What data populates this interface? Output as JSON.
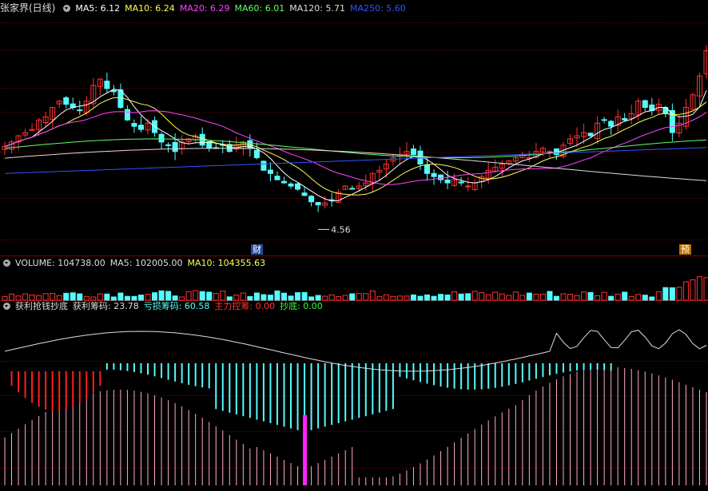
{
  "main": {
    "title": "张家界(日线)",
    "ma_labels": [
      {
        "text": "MA5: 6.12",
        "color": "#ffffff"
      },
      {
        "text": "MA10: 6.24",
        "color": "#ffff55"
      },
      {
        "text": "MA20: 6.29",
        "color": "#ff44ff"
      },
      {
        "text": "MA60: 6.01",
        "color": "#66ff66"
      },
      {
        "text": "MA120: 5.71",
        "color": "#dddddd"
      },
      {
        "text": "MA250: 5.60",
        "color": "#3355ff"
      }
    ],
    "low_label": "4.56",
    "badge_left": "财",
    "badge_right": "预"
  },
  "volume": {
    "labels": [
      {
        "text": "VOLUME: 104738.00",
        "color": "#dddddd"
      },
      {
        "text": "MA5: 102005.00",
        "color": "#dddddd"
      },
      {
        "text": "MA10: 104355.63",
        "color": "#ffff55"
      }
    ]
  },
  "indicator": {
    "labels": [
      {
        "text": "获利抢钱抄底",
        "color": "#dddddd"
      },
      {
        "text": "获利筹码: 23.78",
        "color": "#dddddd"
      },
      {
        "text": "亏损筹码: 60.58",
        "color": "#55ffff"
      },
      {
        "text": "主力控筹: 0.00",
        "color": "#ff3333"
      },
      {
        "text": "抄底: 0.00",
        "color": "#33ff33"
      }
    ]
  },
  "colors": {
    "up": "#ff3232",
    "down": "#54fcfc",
    "grid": "#5a0000",
    "bg": "#000000"
  },
  "chart_data": {
    "type": "candlestick",
    "series_close": [
      5.88,
      5.95,
      6.05,
      6.1,
      6.15,
      6.3,
      6.35,
      6.5,
      6.6,
      6.55,
      6.5,
      6.45,
      6.6,
      6.85,
      6.95,
      6.8,
      6.75,
      6.5,
      6.3,
      6.2,
      6.15,
      6.25,
      6.1,
      5.95,
      5.9,
      5.8,
      5.95,
      6.0,
      6.05,
      5.9,
      5.85,
      5.85,
      5.9,
      5.8,
      5.9,
      5.95,
      5.85,
      5.7,
      5.5,
      5.45,
      5.35,
      5.3,
      5.25,
      5.2,
      5.1,
      5.0,
      4.95,
      4.98,
      5.02,
      5.15,
      5.25,
      5.2,
      5.25,
      5.3,
      5.45,
      5.5,
      5.6,
      5.7,
      5.75,
      5.8,
      5.75,
      5.6,
      5.45,
      5.4,
      5.35,
      5.3,
      5.35,
      5.3,
      5.25,
      5.3,
      5.4,
      5.5,
      5.55,
      5.6,
      5.65,
      5.7,
      5.75,
      5.7,
      5.8,
      5.85,
      5.8,
      5.75,
      5.9,
      6.0,
      6.05,
      6.1,
      6.05,
      6.25,
      6.3,
      6.2,
      6.35,
      6.3,
      6.4,
      6.6,
      6.5,
      6.45,
      6.55,
      6.4,
      6.1,
      6.25,
      6.5,
      6.7,
      7.0,
      7.4
    ],
    "ma_values": {
      "MA5": 6.12,
      "MA10": 6.24,
      "MA20": 6.29,
      "MA60": 6.01,
      "MA120": 5.71,
      "MA250": 5.6
    },
    "low": 4.56
  }
}
